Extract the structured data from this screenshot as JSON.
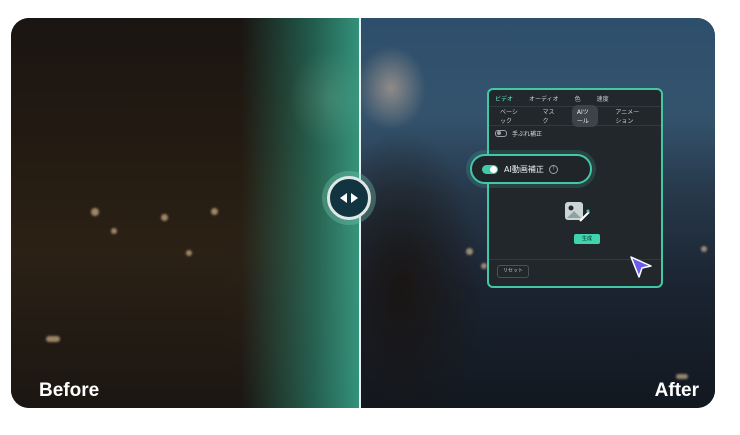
{
  "labels": {
    "before": "Before",
    "after": "After"
  },
  "panel": {
    "top_tabs": [
      "ビデオ",
      "オーディオ",
      "色",
      "速度"
    ],
    "active_top_tab": 0,
    "sub_tabs": [
      "ベーシック",
      "マスク",
      "AIツール",
      "アニメーション"
    ],
    "active_sub_tab": 2,
    "stabilize_label": "手ぶれ補正",
    "ai_feature_label": "AI動画補正",
    "help_glyph": "?",
    "generate_label": "生成",
    "reset_label": "リセット"
  },
  "colors": {
    "accent": "#44c7a6",
    "panel_bg": "#22272b",
    "handle_bg": "#123440"
  },
  "icons": {
    "compare": "compare-arrows-icon",
    "cursor": "pointer-cursor-icon",
    "image_wand": "image-wand-icon"
  }
}
